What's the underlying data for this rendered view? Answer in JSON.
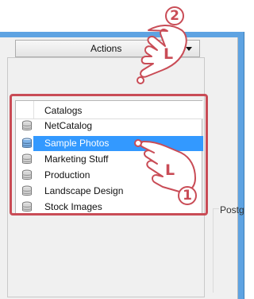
{
  "toolbar": {
    "actions_label": "Actions"
  },
  "catalog_list": {
    "header": "Catalogs",
    "items": [
      {
        "label": "NetCatalog",
        "selected": false,
        "icon": "database-icon"
      },
      {
        "label": "Sample Photos",
        "selected": true,
        "icon": "database-icon"
      },
      {
        "label": "Marketing Stuff",
        "selected": false,
        "icon": "database-icon"
      },
      {
        "label": "Production",
        "selected": false,
        "icon": "database-icon"
      },
      {
        "label": "Landscape Design",
        "selected": false,
        "icon": "database-icon"
      },
      {
        "label": "Stock Images",
        "selected": false,
        "icon": "database-icon"
      }
    ]
  },
  "right_panel": {
    "partial_label": "Postg"
  },
  "annotations": {
    "step_one": "1",
    "step_two": "2",
    "click_hint_one": "L",
    "click_hint_two": "L"
  },
  "colors": {
    "window_accent": "#5ea3e2",
    "selection": "#3399ff",
    "annotation": "#c94c56"
  }
}
